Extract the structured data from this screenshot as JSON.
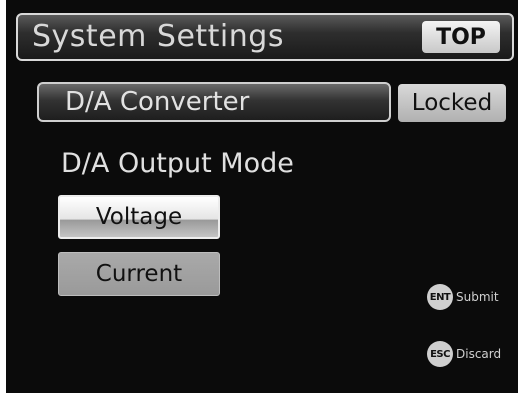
{
  "header": {
    "title": "System Settings",
    "badge": "TOP"
  },
  "section": {
    "label": "D/A Converter",
    "status": "Locked"
  },
  "mode": {
    "label": "D/A Output Mode",
    "options": [
      {
        "label": "Voltage",
        "selected": true
      },
      {
        "label": "Current",
        "selected": false
      }
    ]
  },
  "keys": {
    "submit": {
      "key": "ENT",
      "label": "Submit"
    },
    "discard": {
      "key": "ESC",
      "label": "Discard"
    }
  }
}
